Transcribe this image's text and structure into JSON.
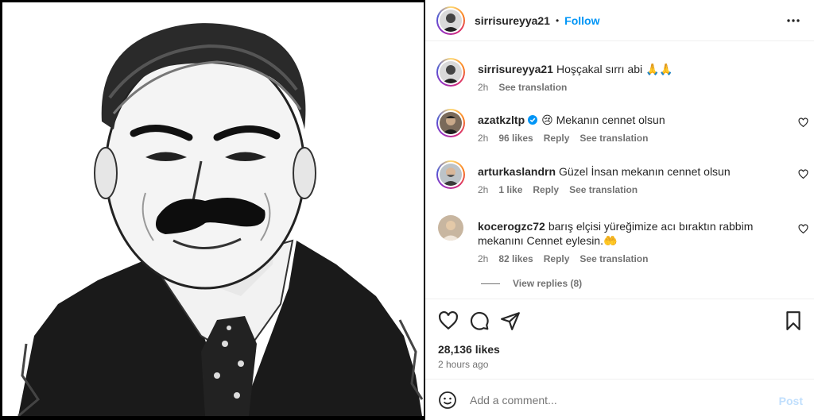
{
  "header": {
    "username": "sirrisureyya21",
    "separator": "•",
    "follow_label": "Follow"
  },
  "comments": [
    {
      "username": "sirrisureyya21",
      "text": "Hoşçakal sırrı abi 🙏🙏",
      "time": "2h",
      "likes": "",
      "reply": "",
      "translate": "See translation"
    },
    {
      "username": "azatkzltp",
      "emoji": "😢",
      "text": "Mekanın cennet olsun",
      "time": "2h",
      "likes": "96 likes",
      "reply": "Reply",
      "translate": "See translation"
    },
    {
      "username": "arturkaslandrn",
      "text": "Güzel İnsan mekanın cennet olsun",
      "time": "2h",
      "likes": "1 like",
      "reply": "Reply",
      "translate": "See translation"
    },
    {
      "username": "kocerogzc72",
      "text": "barış elçisi yüreğimize acı bıraktın rabbim mekanını Cennet eylesin.🤲",
      "time": "2h",
      "likes": "82 likes",
      "reply": "Reply",
      "translate": "See translation"
    }
  ],
  "view_replies": "View replies (8)",
  "likes_count": "28,136 likes",
  "posted_ago": "2 hours ago",
  "add_comment_placeholder": "Add a comment...",
  "post_label": "Post",
  "colors": {
    "link_blue": "#0095f6",
    "post_disabled": "#c0dffd",
    "text": "#262626",
    "muted": "#737373",
    "verified": "#0095f6"
  },
  "icons": [
    "more-icon",
    "heart-icon",
    "comment-icon",
    "share-icon",
    "bookmark-icon",
    "emoji-icon",
    "verified-icon"
  ]
}
